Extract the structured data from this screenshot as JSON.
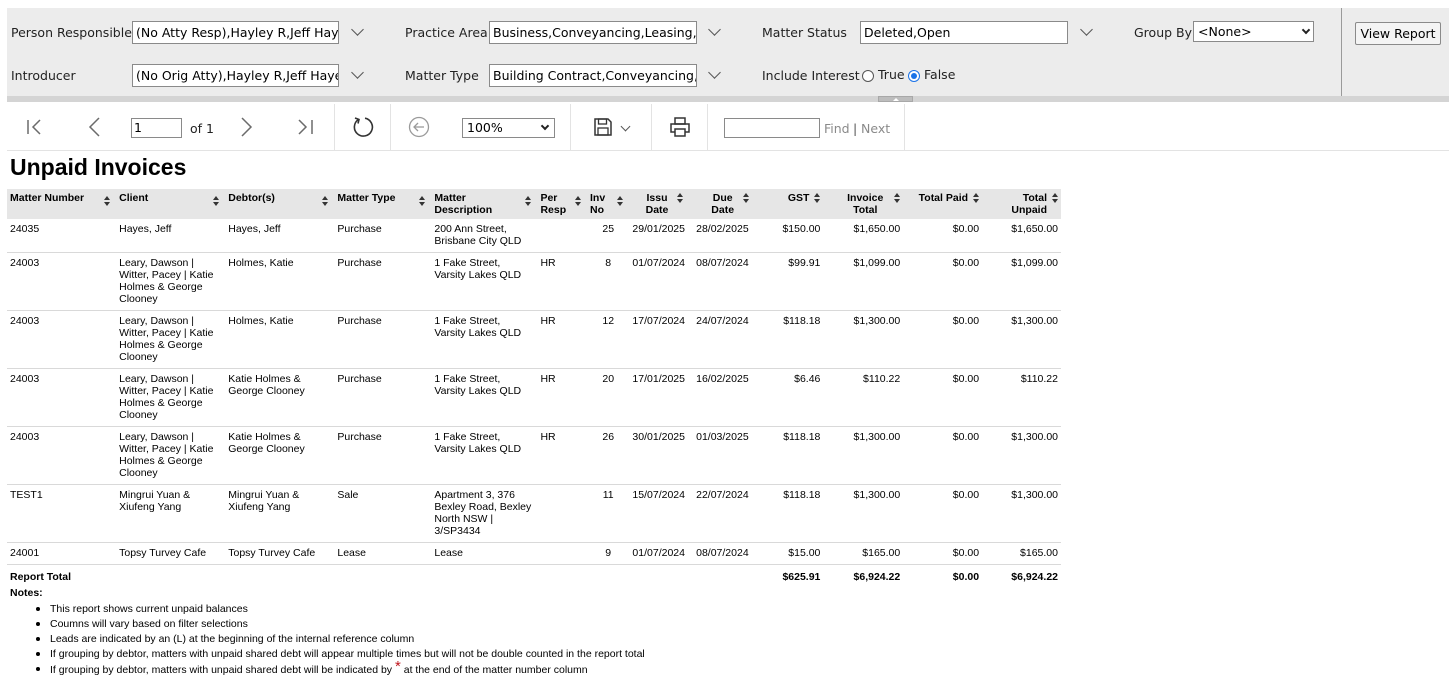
{
  "params": {
    "person_responsible": {
      "label": "Person Responsible",
      "value": "(No Atty Resp),Hayley R,Jeff Hayes"
    },
    "practice_area": {
      "label": "Practice Area",
      "value": "Business,Conveyancing,Leasing,Mo"
    },
    "matter_status": {
      "label": "Matter Status",
      "value": "Deleted,Open"
    },
    "group_by": {
      "label": "Group By",
      "value": "<None>"
    },
    "introducer": {
      "label": "Introducer",
      "value": "(No Orig Atty),Hayley R,Jeff Hayes"
    },
    "matter_type": {
      "label": "Matter Type",
      "value": "Building Contract,Conveyancing,Co"
    },
    "include_interest": {
      "label": "Include Interest",
      "true_label": "True",
      "false_label": "False",
      "selected": "False"
    },
    "view_report_label": "View Report"
  },
  "toolbar": {
    "page_value": "1",
    "page_of": "of 1",
    "zoom": "100%",
    "find_label": "Find",
    "separator": "|",
    "next_label": "Next",
    "icons": [
      "first-page-icon",
      "previous-page-icon",
      "next-page-icon",
      "last-page-icon",
      "refresh-icon",
      "back-icon",
      "save-icon",
      "print-icon"
    ]
  },
  "report": {
    "title": "Unpaid Invoices",
    "columns": [
      "Matter Number",
      "Client",
      "Debtor(s)",
      "Matter Type",
      "Matter Description",
      "Per Resp",
      "Inv No",
      "Issu Date",
      "Due Date",
      "GST",
      "Invoice Total",
      "Total Paid",
      "Total Unpaid"
    ],
    "rows": [
      {
        "matter_number": "24035",
        "client": "Hayes, Jeff",
        "debtors": "Hayes, Jeff",
        "matter_type": "Purchase",
        "description": "200 Ann Street, Brisbane City QLD",
        "per_resp": "",
        "inv_no": "25",
        "issue_date": "29/01/2025",
        "due_date": "28/02/2025",
        "gst": "$150.00",
        "invoice_total": "$1,650.00",
        "total_paid": "$0.00",
        "total_unpaid": "$1,650.00"
      },
      {
        "matter_number": "24003",
        "client": "Leary, Dawson | Witter, Pacey | Katie Holmes & George Clooney",
        "debtors": "Holmes, Katie",
        "matter_type": "Purchase",
        "description": "1 Fake Street, Varsity Lakes QLD",
        "per_resp": "HR",
        "inv_no": "8",
        "issue_date": "01/07/2024",
        "due_date": "08/07/2024",
        "gst": "$99.91",
        "invoice_total": "$1,099.00",
        "total_paid": "$0.00",
        "total_unpaid": "$1,099.00"
      },
      {
        "matter_number": "24003",
        "client": "Leary, Dawson | Witter, Pacey | Katie Holmes & George Clooney",
        "debtors": "Holmes, Katie",
        "matter_type": "Purchase",
        "description": "1 Fake Street, Varsity Lakes QLD",
        "per_resp": "HR",
        "inv_no": "12",
        "issue_date": "17/07/2024",
        "due_date": "24/07/2024",
        "gst": "$118.18",
        "invoice_total": "$1,300.00",
        "total_paid": "$0.00",
        "total_unpaid": "$1,300.00"
      },
      {
        "matter_number": "24003",
        "client": "Leary, Dawson | Witter, Pacey | Katie Holmes & George Clooney",
        "debtors": "Katie Holmes & George Clooney",
        "matter_type": "Purchase",
        "description": "1 Fake Street, Varsity Lakes QLD",
        "per_resp": "HR",
        "inv_no": "20",
        "issue_date": "17/01/2025",
        "due_date": "16/02/2025",
        "gst": "$6.46",
        "invoice_total": "$110.22",
        "total_paid": "$0.00",
        "total_unpaid": "$110.22"
      },
      {
        "matter_number": "24003",
        "client": "Leary, Dawson | Witter, Pacey | Katie Holmes & George Clooney",
        "debtors": "Katie Holmes & George Clooney",
        "matter_type": "Purchase",
        "description": "1 Fake Street, Varsity Lakes QLD",
        "per_resp": "HR",
        "inv_no": "26",
        "issue_date": "30/01/2025",
        "due_date": "01/03/2025",
        "gst": "$118.18",
        "invoice_total": "$1,300.00",
        "total_paid": "$0.00",
        "total_unpaid": "$1,300.00"
      },
      {
        "matter_number": "TEST1",
        "client": "Mingrui Yuan & Xiufeng Yang",
        "debtors": "Mingrui Yuan & Xiufeng Yang",
        "matter_type": "Sale",
        "description": "Apartment 3, 376 Bexley Road, Bexley North NSW | 3/SP3434",
        "per_resp": "",
        "inv_no": "11",
        "issue_date": "15/07/2024",
        "due_date": "22/07/2024",
        "gst": "$118.18",
        "invoice_total": "$1,300.00",
        "total_paid": "$0.00",
        "total_unpaid": "$1,300.00"
      },
      {
        "matter_number": "24001",
        "client": "Topsy Turvey Cafe",
        "debtors": "Topsy Turvey Cafe",
        "matter_type": "Lease",
        "description": "Lease",
        "per_resp": "",
        "inv_no": "9",
        "issue_date": "01/07/2024",
        "due_date": "08/07/2024",
        "gst": "$15.00",
        "invoice_total": "$165.00",
        "total_paid": "$0.00",
        "total_unpaid": "$165.00"
      }
    ],
    "total": {
      "label": "Report Total",
      "gst": "$625.91",
      "invoice_total": "$6,924.22",
      "total_paid": "$0.00",
      "total_unpaid": "$6,924.22"
    }
  },
  "notes": {
    "title": "Notes:",
    "items": [
      "This report shows current unpaid balances",
      "Coumns will vary based on filter selections",
      "Leads are indicated by an (L) at the beginning of the internal reference column",
      "If grouping by debtor, matters with unpaid shared debt will appear multiple times but will not be double counted in the report total",
      "If grouping by debtor, matters with unpaid shared debt will be indicated by"
    ],
    "last_suffix": "at the end of the matter number column",
    "star": "*"
  }
}
